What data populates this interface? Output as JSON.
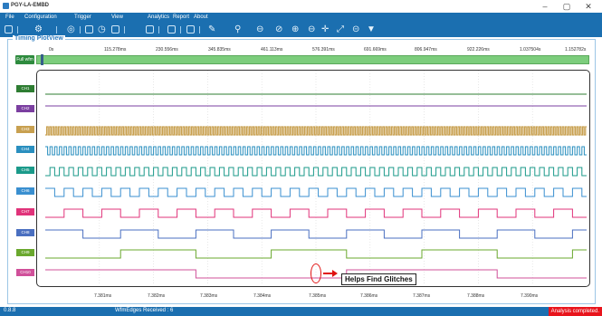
{
  "app": {
    "title": "PGY-LA-EMBD"
  },
  "window_controls": {
    "minimize": "–",
    "maximize": "▢",
    "close": "✕"
  },
  "menu": [
    "File",
    "Configuration",
    "Trigger",
    "View",
    "Analytics",
    "Report",
    "About"
  ],
  "toolbar_icons": [
    "layout-icon",
    "run-icon",
    "stop-icon",
    "single-shot-icon",
    "timer-icon",
    "list-icon",
    "chart-icon",
    "waveform-icon",
    "help-icon",
    "pen-icon",
    "marker-icon",
    "zoom-full-icon",
    "zoom-fit-icon",
    "zoom-in-icon",
    "zoom-out-icon",
    "pan-icon",
    "expand-icon",
    "minus-icon",
    "filter-icon"
  ],
  "panel": {
    "title": "Timing PlotView"
  },
  "top_axis": [
    "0s",
    "115.278ms",
    "230.556ms",
    "345.835ms",
    "461.113ms",
    "576.391ms",
    "691.669ms",
    "806.947ms",
    "922.226ms",
    "1.037504s",
    "1.152782s"
  ],
  "full_waveform": {
    "label": "Full wfm",
    "cursor_fraction": 0.01
  },
  "channels": [
    {
      "label": "CH1",
      "color": "#2e7d32"
    },
    {
      "label": "CH2",
      "color": "#7b3fa0"
    },
    {
      "label": "CH3",
      "color": "#c8a050"
    },
    {
      "label": "CH4",
      "color": "#2a8fbf"
    },
    {
      "label": "CH5",
      "color": "#1b9a8a"
    },
    {
      "label": "CH6",
      "color": "#3a8fd0"
    },
    {
      "label": "CH7",
      "color": "#e0337a"
    },
    {
      "label": "CH8",
      "color": "#4a6fc0"
    },
    {
      "label": "CH9",
      "color": "#6aa82e"
    },
    {
      "label": "CH10",
      "color": "#d0509a"
    }
  ],
  "bottom_axis": [
    "7.381ms",
    "7.382ms",
    "7.383ms",
    "7.384ms",
    "7.385ms",
    "7.386ms",
    "7.387ms",
    "7.388ms",
    "7.390ms"
  ],
  "annotation": {
    "text": "Helps Find Glitches"
  },
  "status": {
    "version": "0.8.8",
    "edges": "WfmEdges Received : 6",
    "result": "Analysis completed."
  }
}
